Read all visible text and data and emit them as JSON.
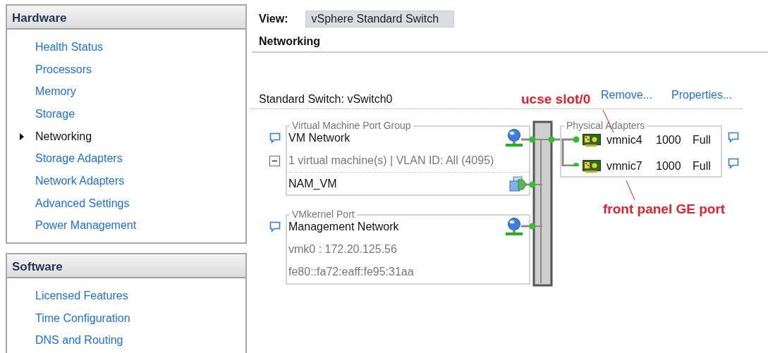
{
  "sidebar": {
    "sections": [
      {
        "title": "Hardware",
        "items": [
          {
            "label": "Health Status",
            "selected": false
          },
          {
            "label": "Processors",
            "selected": false
          },
          {
            "label": "Memory",
            "selected": false
          },
          {
            "label": "Storage",
            "selected": false
          },
          {
            "label": "Networking",
            "selected": true
          },
          {
            "label": "Storage Adapters",
            "selected": false
          },
          {
            "label": "Network Adapters",
            "selected": false
          },
          {
            "label": "Advanced Settings",
            "selected": false
          },
          {
            "label": "Power Management",
            "selected": false
          }
        ]
      },
      {
        "title": "Software",
        "items": [
          {
            "label": "Licensed Features",
            "selected": false
          },
          {
            "label": "Time Configuration",
            "selected": false
          },
          {
            "label": "DNS and Routing",
            "selected": false
          }
        ]
      }
    ]
  },
  "view": {
    "label": "View:",
    "value": "vSphere Standard Switch"
  },
  "heading": "Networking",
  "switch": {
    "title": "Standard Switch: vSwitch0",
    "actions": [
      "Remove...",
      "Properties..."
    ]
  },
  "port_groups": [
    {
      "kind": "vm",
      "legend": "Virtual Machine Port Group",
      "name": "VM Network",
      "expanded": true,
      "details": [
        "1 virtual machine(s) | VLAN ID: All (4095)"
      ],
      "vms": [
        "NAM_VM"
      ]
    },
    {
      "kind": "vmkernel",
      "legend": "VMkernel Port",
      "name": "Management Network",
      "details": [
        "vmk0 : 172.20.125.56",
        "fe80::fa72:eaff:fe95:31aa"
      ]
    }
  ],
  "physical_adapters": {
    "legend": "Physical Adapters",
    "adapters": [
      {
        "name": "vmnic4",
        "speed": "1000",
        "duplex": "Full"
      },
      {
        "name": "vmnic7",
        "speed": "1000",
        "duplex": "Full"
      }
    ]
  },
  "annotations": [
    "ucse slot/0",
    "front panel GE port"
  ]
}
